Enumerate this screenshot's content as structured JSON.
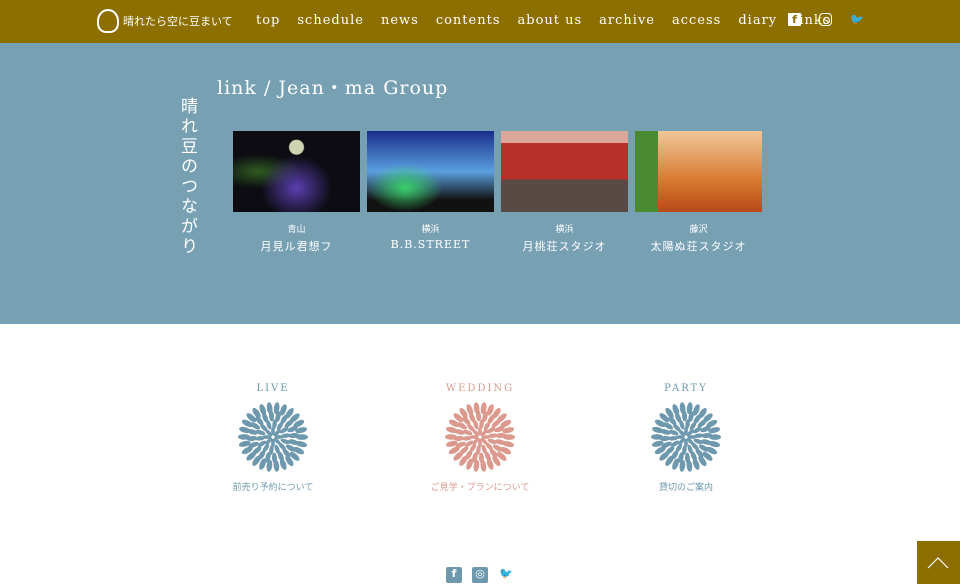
{
  "nav": {
    "logo_text": "晴れたら空に豆まいて",
    "items": [
      "top",
      "schedule",
      "news",
      "contents",
      "about us",
      "archive",
      "access",
      "diary",
      "links"
    ],
    "social": [
      "facebook-icon",
      "instagram-icon",
      "twitter-icon"
    ]
  },
  "links": {
    "vertical_title": "晴れ豆のつながり",
    "title": "link / Jean・ma Group",
    "cards": [
      {
        "area": "青山",
        "name": "月見ル君想フ"
      },
      {
        "area": "横浜",
        "name": "B.B.STREET"
      },
      {
        "area": "横浜",
        "name": "月桃荘スタジオ"
      },
      {
        "area": "藤沢",
        "name": "太陽ぬ荘スタジオ"
      }
    ]
  },
  "services": [
    {
      "label": "LIVE",
      "desc": "前売り予約について",
      "color": "#6e98ad"
    },
    {
      "label": "WEDDING",
      "desc": "ご見学・プランについて",
      "color": "#dc9a8f"
    },
    {
      "label": "PARTY",
      "desc": "貸切のご案内",
      "color": "#6e98ad"
    }
  ],
  "colors": {
    "nav": "#8d6f00",
    "section": "#77a0b3"
  }
}
